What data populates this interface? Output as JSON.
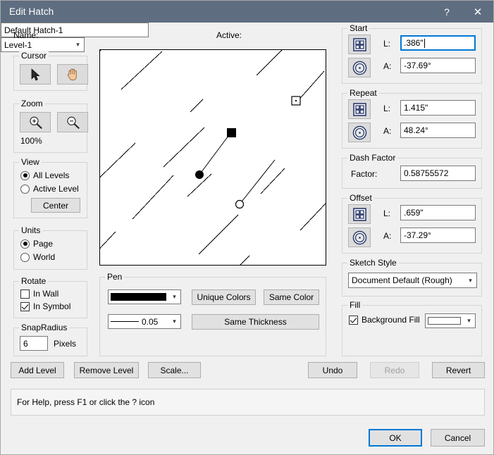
{
  "window": {
    "title": "Edit Hatch",
    "help_icon": "?",
    "close_icon": "✕",
    "titlebar_color": "#5e6d80",
    "accent_color": "#0078d7"
  },
  "header": {
    "name_label": "Name:",
    "name_value": "Default Hatch-1",
    "active_label": "Active:",
    "active_value": "Level-1"
  },
  "cursor": {
    "legend": "Cursor",
    "arrow_icon": "arrow-cursor-icon",
    "pan_icon": "hand-pan-icon"
  },
  "zoom": {
    "legend": "Zoom",
    "zoom_in_icon": "zoom-in-icon",
    "zoom_out_icon": "zoom-out-icon",
    "level": "100%"
  },
  "view": {
    "legend": "View",
    "options": [
      {
        "label": "All Levels",
        "selected": true
      },
      {
        "label": "Active Level",
        "selected": false
      }
    ],
    "center_button": "Center"
  },
  "units": {
    "legend": "Units",
    "options": [
      {
        "label": "Page",
        "selected": true
      },
      {
        "label": "World",
        "selected": false
      }
    ]
  },
  "rotate": {
    "legend": "Rotate",
    "options": [
      {
        "label": "In Wall",
        "checked": false
      },
      {
        "label": "In Symbol",
        "checked": true
      }
    ]
  },
  "snapradius": {
    "legend": "SnapRadius",
    "value": "6",
    "units_label": "Pixels"
  },
  "preview": {
    "name": "hatch-preview-canvas",
    "hatch_angle_deg": 48.24,
    "markers": [
      "origin-dot",
      "repeat-square",
      "offset-circle",
      "end-square-outline"
    ]
  },
  "pen": {
    "legend": "Pen",
    "color_swatch": "#000000",
    "thickness_value": "0.05",
    "unique_colors_button": "Unique Colors",
    "same_color_button": "Same Color",
    "same_thickness_button": "Same Thickness"
  },
  "start": {
    "legend": "Start",
    "grid_icon": "grid-pane-icon",
    "target_icon": "target-circle-icon",
    "l_label": "L:",
    "l_value": ".386\"",
    "a_label": "A:",
    "a_value": "-37.69°"
  },
  "repeat": {
    "legend": "Repeat",
    "grid_icon": "grid-pane-icon",
    "target_icon": "target-circle-icon",
    "l_label": "L:",
    "l_value": "1.415\"",
    "a_label": "A:",
    "a_value": "48.24°"
  },
  "dash_factor": {
    "legend": "Dash Factor",
    "factor_label": "Factor:",
    "factor_value": "0.58755572"
  },
  "offset": {
    "legend": "Offset",
    "grid_icon": "grid-pane-icon",
    "target_icon": "target-circle-icon",
    "l_label": "L:",
    "l_value": ".659\"",
    "a_label": "A:",
    "a_value": "-37.29°"
  },
  "sketch_style": {
    "legend": "Sketch Style",
    "value": "Document Default (Rough)"
  },
  "fill": {
    "legend": "Fill",
    "background_fill_label": "Background Fill",
    "background_fill_checked": true,
    "swatch_color": "#ffffff"
  },
  "level_actions": {
    "add_level": "Add Level",
    "remove_level": "Remove Level",
    "scale": "Scale..."
  },
  "history_actions": {
    "undo": "Undo",
    "redo": "Redo",
    "redo_disabled": true,
    "revert": "Revert"
  },
  "status": {
    "text": "For Help, press F1 or click the ? icon"
  },
  "footer": {
    "ok": "OK",
    "cancel": "Cancel"
  }
}
